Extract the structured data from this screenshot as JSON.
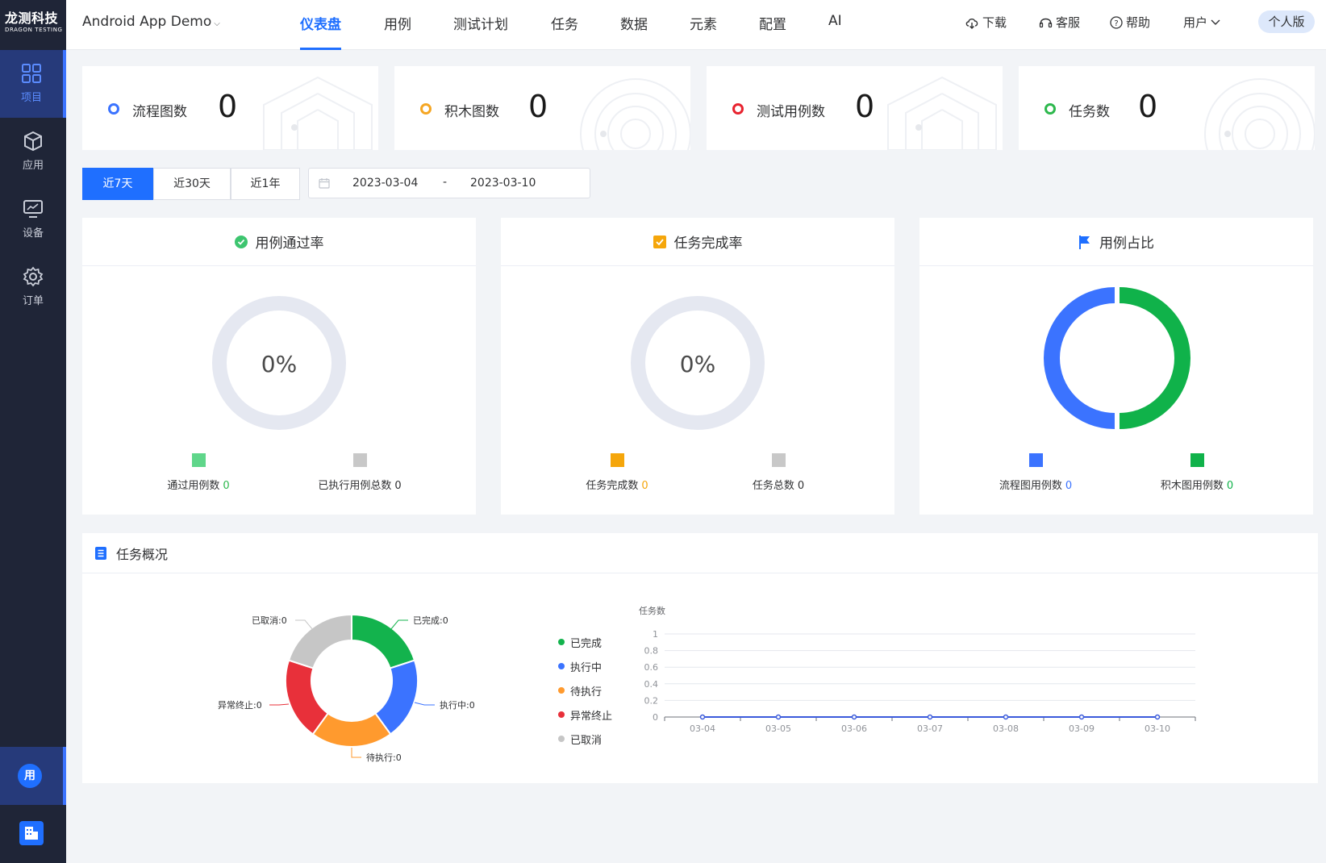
{
  "brand": {
    "name": "龙测科技",
    "sub": "DRAGON TESTING"
  },
  "sidebar": {
    "items": [
      {
        "label": "项目",
        "icon": "grid-icon"
      },
      {
        "label": "应用",
        "icon": "cube-icon"
      },
      {
        "label": "设备",
        "icon": "monitor-icon"
      },
      {
        "label": "订单",
        "icon": "gear-icon"
      }
    ],
    "user_avatar": "用"
  },
  "header": {
    "project": "Android App Demo",
    "tabs": [
      "仪表盘",
      "用例",
      "测试计划",
      "任务",
      "数据",
      "元素",
      "配置",
      "AI"
    ],
    "active_tab": "仪表盘",
    "tools": {
      "download": "下载",
      "service": "客服",
      "help": "帮助",
      "user": "用户"
    },
    "edition": "个人版"
  },
  "stats": [
    {
      "label": "流程图数",
      "value": "0",
      "color": "#3b73ff"
    },
    {
      "label": "积木图数",
      "value": "0",
      "color": "#f5a623"
    },
    {
      "label": "测试用例数",
      "value": "0",
      "color": "#e8232f"
    },
    {
      "label": "任务数",
      "value": "0",
      "color": "#2db84d"
    }
  ],
  "range": {
    "options": [
      "近7天",
      "近30天",
      "近1年"
    ],
    "active": "近7天",
    "start": "2023-03-04",
    "sep": "-",
    "end": "2023-03-10"
  },
  "panels": {
    "pass_rate": {
      "title": "用例通过率",
      "percent": "0%",
      "legend": [
        {
          "label": "通过用例数",
          "value": "0",
          "color": "#5fd68a",
          "value_color": "#2db84d"
        },
        {
          "label": "已执行用例总数",
          "value": "0",
          "color": "#c8c8c8",
          "value_color": "#303133"
        }
      ]
    },
    "task_rate": {
      "title": "任务完成率",
      "percent": "0%",
      "legend": [
        {
          "label": "任务完成数",
          "value": "0",
          "color": "#f5a60b",
          "value_color": "#f5a60b"
        },
        {
          "label": "任务总数",
          "value": "0",
          "color": "#c8c8c8",
          "value_color": "#303133"
        }
      ]
    },
    "case_ratio": {
      "title": "用例占比",
      "legend": [
        {
          "label": "流程图用例数",
          "value": "0",
          "color": "#3b73ff",
          "value_color": "#3b73ff"
        },
        {
          "label": "积木图用例数",
          "value": "0",
          "color": "#10b24a",
          "value_color": "#10b24a"
        }
      ]
    }
  },
  "overview": {
    "title": "任务概况",
    "donut_labels": [
      "已完成:0",
      "执行中:0",
      "待执行:0",
      "异常终止:0",
      "已取消:0"
    ],
    "legend": [
      {
        "label": "已完成",
        "color": "#13b34d"
      },
      {
        "label": "执行中",
        "color": "#3b73ff"
      },
      {
        "label": "待执行",
        "color": "#ff9a2e"
      },
      {
        "label": "异常终止",
        "color": "#e8303a"
      },
      {
        "label": "已取消",
        "color": "#c6c6c6"
      }
    ]
  },
  "chart_data": {
    "type": "line",
    "ylabel": "任务数",
    "x": [
      "03-04",
      "03-05",
      "03-06",
      "03-07",
      "03-08",
      "03-09",
      "03-10"
    ],
    "values": [
      0,
      0,
      0,
      0,
      0,
      0,
      0
    ],
    "ylim": [
      0,
      1
    ],
    "yticks": [
      "0",
      "0.2",
      "0.4",
      "0.6",
      "0.8",
      "1"
    ],
    "line_color": "#3b5bdb",
    "grid": true
  }
}
